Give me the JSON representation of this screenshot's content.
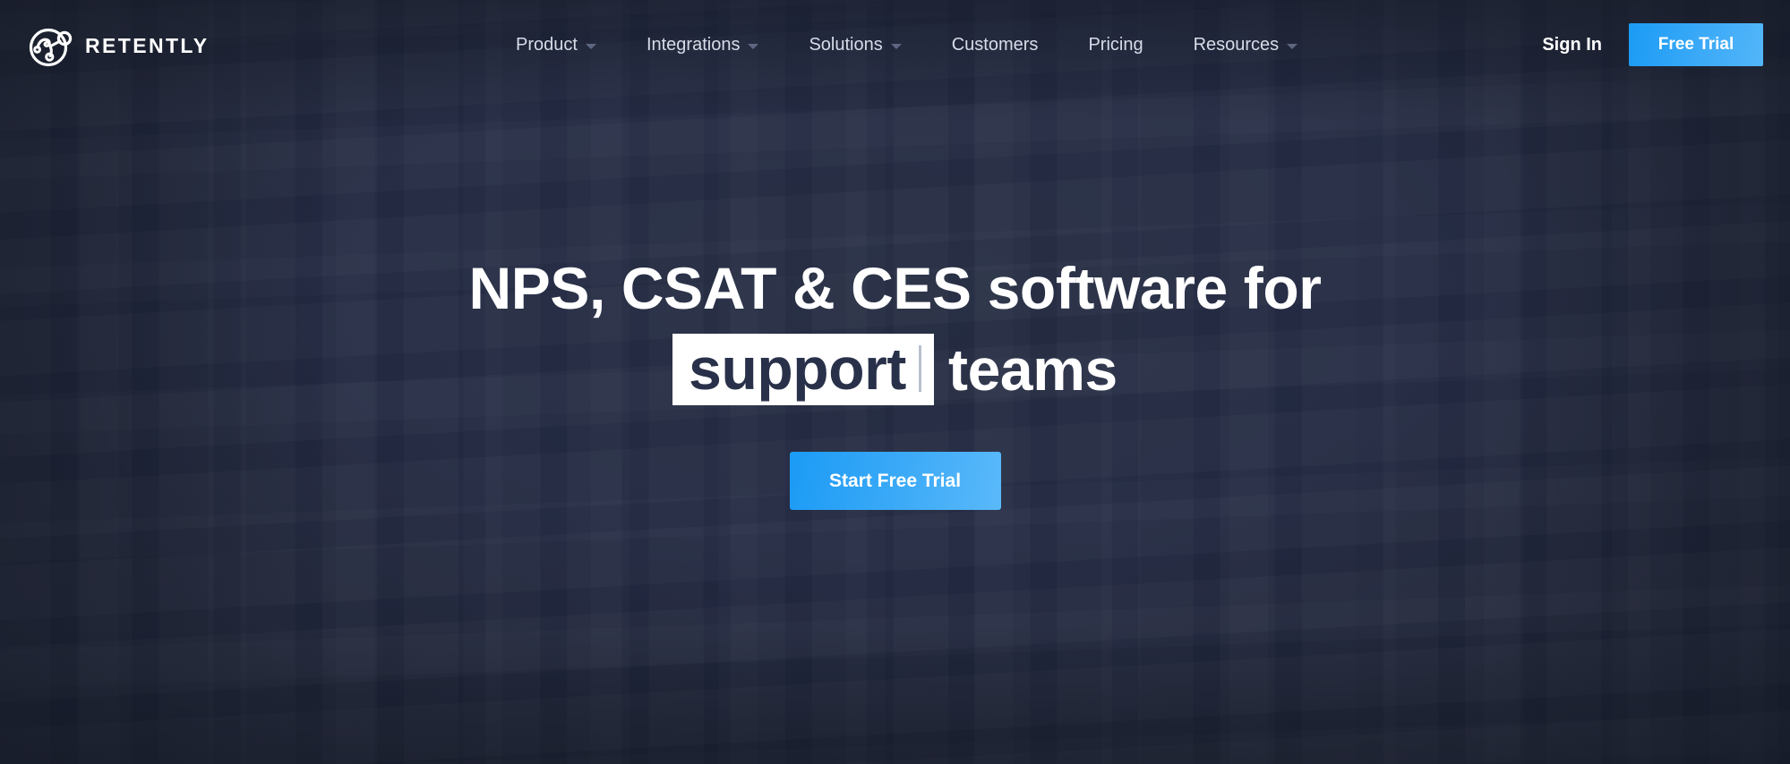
{
  "brand": {
    "name": "RETENTLY",
    "logo_icon": "retently-globe-logo-icon"
  },
  "nav": {
    "items": [
      {
        "label": "Product",
        "has_dropdown": true,
        "icon": "chevron-down-icon"
      },
      {
        "label": "Integrations",
        "has_dropdown": true,
        "icon": "chevron-down-icon"
      },
      {
        "label": "Solutions",
        "has_dropdown": true,
        "icon": "chevron-down-icon"
      },
      {
        "label": "Customers",
        "has_dropdown": false,
        "icon": ""
      },
      {
        "label": "Pricing",
        "has_dropdown": false,
        "icon": ""
      },
      {
        "label": "Resources",
        "has_dropdown": true,
        "icon": "chevron-down-icon"
      }
    ]
  },
  "header_actions": {
    "sign_in_label": "Sign In",
    "free_trial_label": "Free Trial"
  },
  "hero": {
    "title_line_1": "NPS, CSAT & CES software for",
    "typed_word": "support",
    "title_tail": "teams",
    "cta_label": "Start Free Trial"
  },
  "colors": {
    "page_background": "#1e2436",
    "accent_blue": "#2aa2f6",
    "accent_blue_light": "#56b7f9",
    "nav_text": "#d7dce8",
    "heading_text": "#ffffff",
    "typed_word_background": "#ffffff",
    "typed_word_text": "#29314a",
    "caret_color": "#5d6781"
  }
}
